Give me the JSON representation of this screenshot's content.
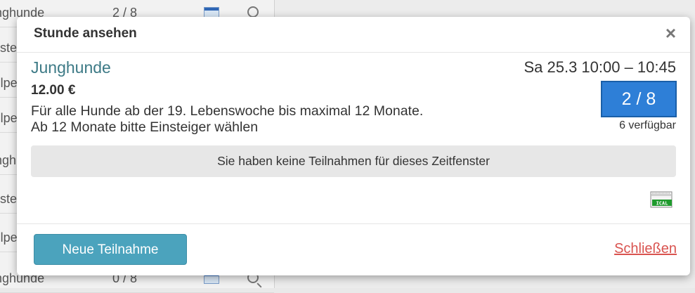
{
  "background": {
    "rows": [
      {
        "name": "Junghunde",
        "count": "2 / 8"
      },
      {
        "name": "Einsteiger",
        "count": ""
      },
      {
        "name": "Welpen",
        "count": ""
      },
      {
        "name": "Welpen",
        "count": ""
      },
      {
        "name": "Junghunde",
        "count": ""
      },
      {
        "name": "Einsteiger",
        "count": ""
      },
      {
        "name": "Welpen",
        "count": ""
      },
      {
        "name": "Junghunde",
        "count": "0 / 8"
      }
    ]
  },
  "modal": {
    "title": "Stunde ansehen",
    "close_symbol": "×",
    "class_name": "Junghunde",
    "datetime": "Sa 25.3  10:00 – 10:45",
    "price": "12.00 €",
    "description_line1": "Für alle Hunde ab der 19. Lebenswoche bis maximal 12 Monate.",
    "description_line2": "Ab 12 Monate bitte Einsteiger wählen",
    "capacity": "2 / 8",
    "available": "6 verfügbar",
    "notice": "Sie haben keine Teilnahmen für dieses Zeitfenster",
    "ical_label": "ICAL",
    "new_booking_button": "Neue Teilnahme",
    "close_link": "Schließen"
  },
  "colors": {
    "accent_teal": "#3d7a86",
    "capacity_blue": "#2e7fd7",
    "button_teal": "#4ba3bd",
    "close_link_red": "#d9534f"
  },
  "icons": [
    "close-icon",
    "ical-calendar-icon",
    "calendar-icon",
    "magnifier-icon"
  ]
}
